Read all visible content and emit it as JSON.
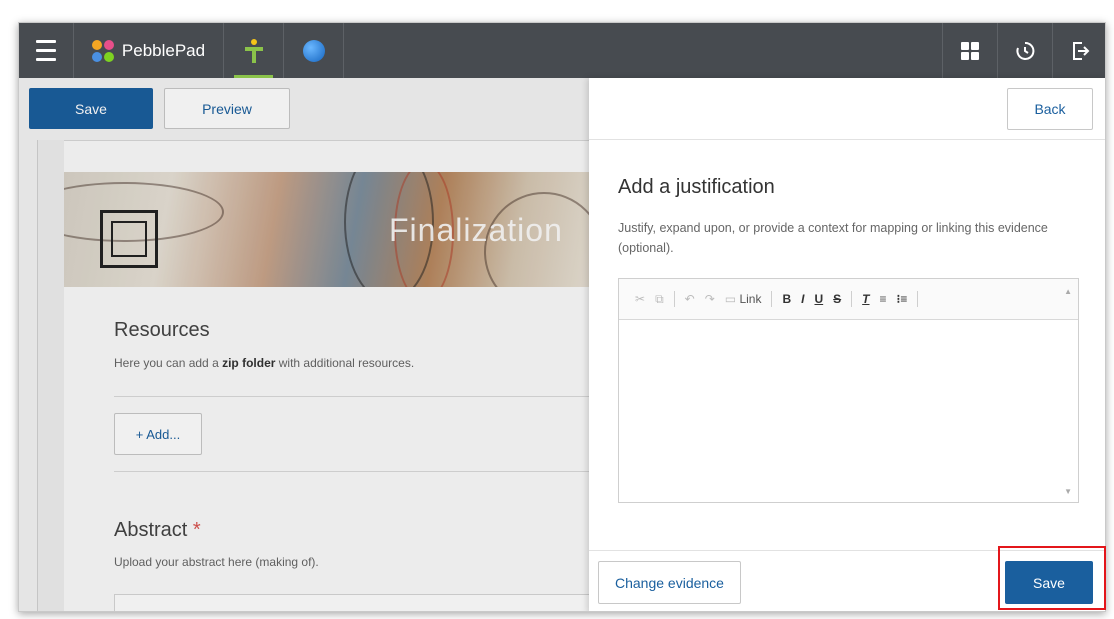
{
  "app": {
    "name": "PebblePad"
  },
  "topbar": {
    "menu_icon": "hamburger-icon",
    "right_icons": [
      "grid-icon",
      "history-icon",
      "logout-icon"
    ]
  },
  "editor": {
    "save_label": "Save",
    "preview_label": "Preview",
    "banner_title": "Finalization",
    "resources": {
      "title": "Resources",
      "desc_prefix": "Here you can add a ",
      "desc_bold": "zip folder",
      "desc_suffix": " with additional resources.",
      "add_label": "+ Add..."
    },
    "abstract": {
      "title": "Abstract",
      "required_mark": "*",
      "desc": "Upload your abstract here (making of)."
    }
  },
  "panel": {
    "back_label": "Back",
    "title": "Add a justification",
    "description": "Justify, expand upon, or provide a context for mapping or linking this evidence (optional).",
    "toolbar": {
      "link_label": "Link",
      "bold": "B",
      "italic": "I",
      "underline": "U",
      "strike": "S"
    },
    "justification_text": "",
    "change_evidence_label": "Change evidence",
    "save_label": "Save"
  },
  "colors": {
    "topbar": "#474b50",
    "primary": "#1a5f9e",
    "highlight": "#e3161b",
    "required": "#d9534f"
  }
}
